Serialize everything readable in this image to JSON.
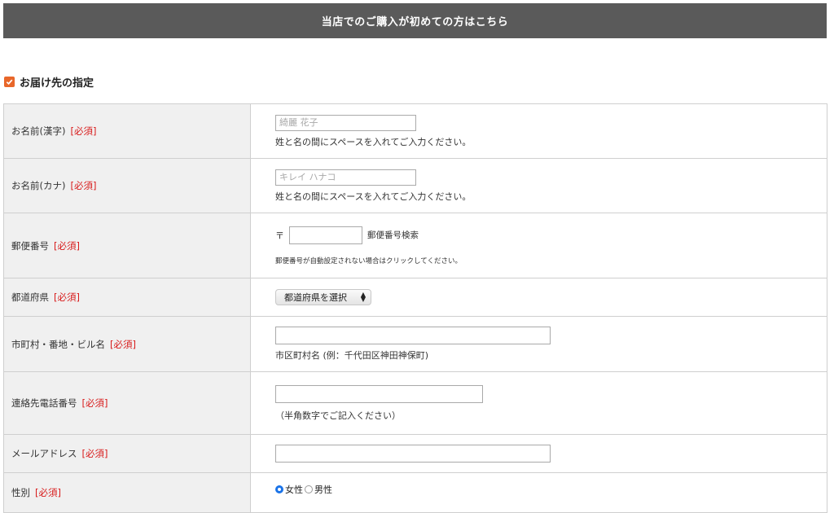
{
  "header": {
    "first_time_banner": "当店でのご購入が初めての方はこちら"
  },
  "section": {
    "title": "お届け先の指定",
    "icon": "checkbox-checked-icon",
    "accent_color": "#e8672a"
  },
  "form": {
    "required_tag": "[必須]",
    "name_kanji": {
      "label": "お名前(漢字)",
      "placeholder": "綺麗 花子",
      "note": "姓と名の間にスペースを入れてご入力ください。"
    },
    "name_kana": {
      "label": "お名前(カナ)",
      "placeholder": "キレイ ハナコ",
      "note": "姓と名の間にスペースを入れてご入力ください。"
    },
    "postal_code": {
      "label": "郵便番号",
      "mark": "〒",
      "search_label": "郵便番号検索",
      "note": "郵便番号が自動設定されない場合はクリックしてください。"
    },
    "prefecture": {
      "label": "都道府県",
      "selected": "都道府県を選択"
    },
    "address": {
      "label": "市町村・番地・ビル名",
      "note": "市区町村名 (例：千代田区神田神保町)"
    },
    "phone": {
      "label": "連絡先電話番号",
      "note": "（半角数字でご記入ください）"
    },
    "email": {
      "label": "メールアドレス"
    },
    "gender": {
      "label": "性別",
      "option_female": "女性",
      "option_male": "男性",
      "selected": "女性"
    }
  }
}
